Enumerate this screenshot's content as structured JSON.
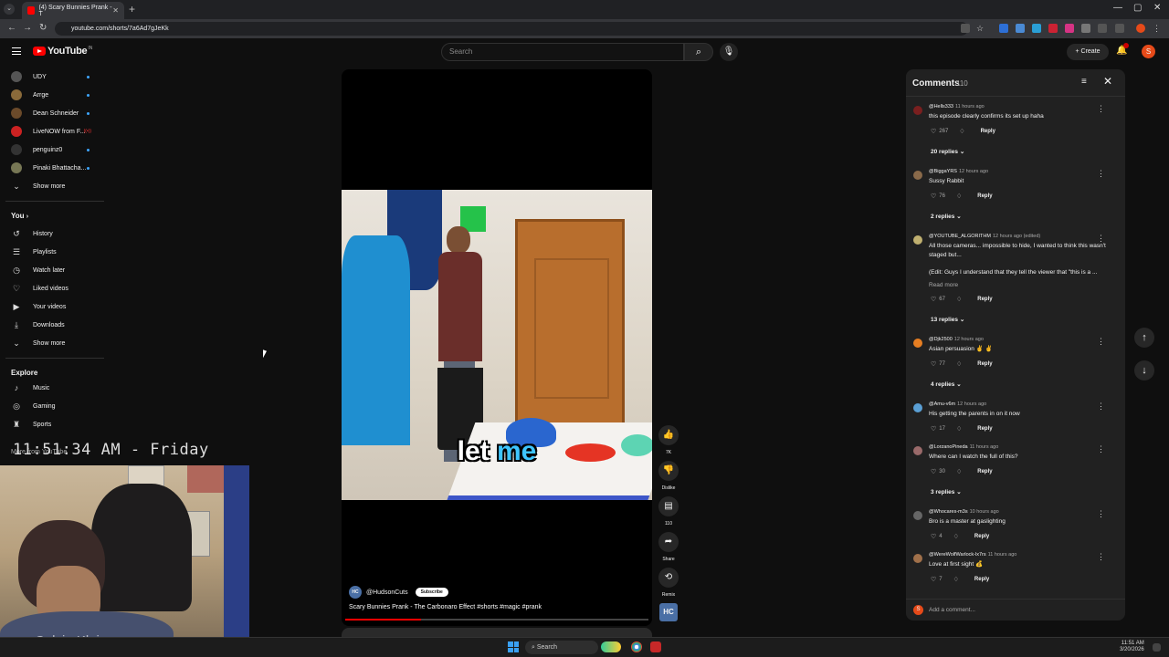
{
  "browser": {
    "tab_title": "(4) Scary Bunnies Prank - T",
    "url": "youtube.com/shorts/7a6Ad7gJeKk"
  },
  "header": {
    "logo_text": "YouTube",
    "logo_superscript": "IN",
    "search_placeholder": "Search",
    "create_label": "Create",
    "notification_count": "9+",
    "avatar_letter": "S"
  },
  "sidebar": {
    "subscriptions": [
      {
        "label": "UDY",
        "color": "#555"
      },
      {
        "label": "Arrge",
        "color": "#8a6a3a"
      },
      {
        "label": "Dean Schneider",
        "color": "#6b4a2a"
      },
      {
        "label": "LiveNOW from F...",
        "color": "#c22"
      },
      {
        "label": "penguinz0",
        "color": "#333"
      },
      {
        "label": "Pinaki Bhattacha...",
        "color": "#775"
      }
    ],
    "show_more": "Show more",
    "you_heading": "You",
    "you_items": [
      {
        "label": "History",
        "icon": "history-icon",
        "glyph": "↺"
      },
      {
        "label": "Playlists",
        "icon": "playlists-icon",
        "glyph": "☰"
      },
      {
        "label": "Watch later",
        "icon": "clock-icon",
        "glyph": "◷"
      },
      {
        "label": "Liked videos",
        "icon": "thumbs-up-icon",
        "glyph": "👍"
      },
      {
        "label": "Your videos",
        "icon": "your-videos-icon",
        "glyph": "▶"
      },
      {
        "label": "Downloads",
        "icon": "download-icon",
        "glyph": "⤓"
      }
    ],
    "show_more_2": "Show more",
    "explore_heading": "Explore",
    "explore_items": [
      {
        "label": "Music",
        "icon": "music-icon",
        "glyph": "♪"
      },
      {
        "label": "Gaming",
        "icon": "gaming-icon",
        "glyph": "◎"
      },
      {
        "label": "Sports",
        "icon": "trophy-icon",
        "glyph": "🏆"
      }
    ],
    "more_from": "More from YouTube"
  },
  "overlay": {
    "clock": "11:51:34 AM - Friday",
    "webcam_watermark": "Calvin Klein"
  },
  "video": {
    "caption_white": "let",
    "caption_blue": "me",
    "channel": "@HudsonCuts",
    "channel_initials": "HC",
    "subscribe": "Subscribe",
    "title": "Scary Bunnies Prank - The Carbonaro Effect #shorts #magic #prank",
    "progress": 0.25
  },
  "actions": {
    "likes": "7K",
    "dislike": "Dislike",
    "comments": "110",
    "share": "Share",
    "remix": "Remix"
  },
  "comments": {
    "title": "Comments",
    "count": "110",
    "add_placeholder": "Add a comment...",
    "items": [
      {
        "author": "@Hells333",
        "time": "11 hours ago",
        "text": "this episode clearly confirms its set up haha",
        "likes": "267",
        "replies": "20 replies",
        "color": "#7a1f1f"
      },
      {
        "author": "@BiggaYRS",
        "time": "12 hours ago",
        "text": "Sussy Rabbit",
        "likes": "76",
        "replies": "2 replies",
        "color": "#8a6a4a"
      },
      {
        "author": "@YOUTUBE_ALGORITHM",
        "time": "12 hours ago (edited)",
        "text": "All those cameras... impossible to hide, I wanted to think this wasn't staged but...\n\n(Edit: Guys I understand that they tell the viewer that \"this is a ...",
        "read_more": "Read more",
        "likes": "67",
        "replies": "13 replies",
        "color": "#c0b070"
      },
      {
        "author": "@Djk2500",
        "time": "12 hours ago",
        "text": "Asian persuasion ✌ ✌",
        "likes": "77",
        "replies": "4 replies",
        "color": "#e67e22"
      },
      {
        "author": "@Amu-v6m",
        "time": "12 hours ago",
        "text": "His getting the parents in on it now",
        "likes": "17",
        "color": "#5a9fd4"
      },
      {
        "author": "@LorzanoPineda",
        "time": "11 hours ago",
        "text": "Where can I watch the full of this?",
        "likes": "30",
        "replies": "3 replies",
        "color": "#9a6a6a"
      },
      {
        "author": "@Whocares-m3s",
        "time": "10 hours ago",
        "text": "Bro is a master at gaslighting",
        "likes": "4",
        "color": "#666"
      },
      {
        "author": "@WereWolfWarlock-lx7rs",
        "time": "11 hours ago",
        "text": "Love at first sight 💰",
        "likes": "7",
        "color": "#a0704a"
      }
    ],
    "reply_label": "Reply"
  },
  "taskbar": {
    "search": "Search",
    "time": "11:51 AM",
    "date": "3/20/2026"
  }
}
